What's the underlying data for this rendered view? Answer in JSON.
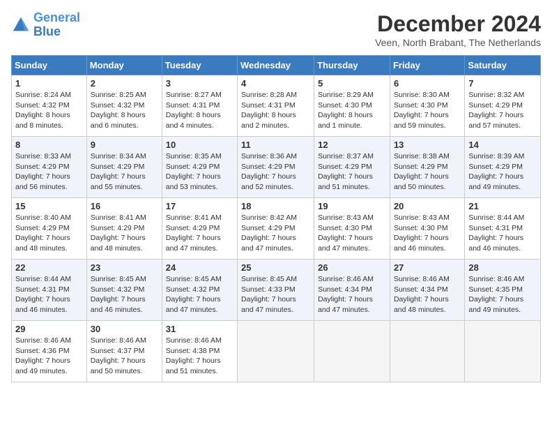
{
  "header": {
    "logo_line1": "General",
    "logo_line2": "Blue",
    "title": "December 2024",
    "subtitle": "Veen, North Brabant, The Netherlands"
  },
  "weekdays": [
    "Sunday",
    "Monday",
    "Tuesday",
    "Wednesday",
    "Thursday",
    "Friday",
    "Saturday"
  ],
  "weeks": [
    [
      {
        "day": "1",
        "info": "Sunrise: 8:24 AM\nSunset: 4:32 PM\nDaylight: 8 hours\nand 8 minutes."
      },
      {
        "day": "2",
        "info": "Sunrise: 8:25 AM\nSunset: 4:32 PM\nDaylight: 8 hours\nand 6 minutes."
      },
      {
        "day": "3",
        "info": "Sunrise: 8:27 AM\nSunset: 4:31 PM\nDaylight: 8 hours\nand 4 minutes."
      },
      {
        "day": "4",
        "info": "Sunrise: 8:28 AM\nSunset: 4:31 PM\nDaylight: 8 hours\nand 2 minutes."
      },
      {
        "day": "5",
        "info": "Sunrise: 8:29 AM\nSunset: 4:30 PM\nDaylight: 8 hours\nand 1 minute."
      },
      {
        "day": "6",
        "info": "Sunrise: 8:30 AM\nSunset: 4:30 PM\nDaylight: 7 hours\nand 59 minutes."
      },
      {
        "day": "7",
        "info": "Sunrise: 8:32 AM\nSunset: 4:29 PM\nDaylight: 7 hours\nand 57 minutes."
      }
    ],
    [
      {
        "day": "8",
        "info": "Sunrise: 8:33 AM\nSunset: 4:29 PM\nDaylight: 7 hours\nand 56 minutes."
      },
      {
        "day": "9",
        "info": "Sunrise: 8:34 AM\nSunset: 4:29 PM\nDaylight: 7 hours\nand 55 minutes."
      },
      {
        "day": "10",
        "info": "Sunrise: 8:35 AM\nSunset: 4:29 PM\nDaylight: 7 hours\nand 53 minutes."
      },
      {
        "day": "11",
        "info": "Sunrise: 8:36 AM\nSunset: 4:29 PM\nDaylight: 7 hours\nand 52 minutes."
      },
      {
        "day": "12",
        "info": "Sunrise: 8:37 AM\nSunset: 4:29 PM\nDaylight: 7 hours\nand 51 minutes."
      },
      {
        "day": "13",
        "info": "Sunrise: 8:38 AM\nSunset: 4:29 PM\nDaylight: 7 hours\nand 50 minutes."
      },
      {
        "day": "14",
        "info": "Sunrise: 8:39 AM\nSunset: 4:29 PM\nDaylight: 7 hours\nand 49 minutes."
      }
    ],
    [
      {
        "day": "15",
        "info": "Sunrise: 8:40 AM\nSunset: 4:29 PM\nDaylight: 7 hours\nand 48 minutes."
      },
      {
        "day": "16",
        "info": "Sunrise: 8:41 AM\nSunset: 4:29 PM\nDaylight: 7 hours\nand 48 minutes."
      },
      {
        "day": "17",
        "info": "Sunrise: 8:41 AM\nSunset: 4:29 PM\nDaylight: 7 hours\nand 47 minutes."
      },
      {
        "day": "18",
        "info": "Sunrise: 8:42 AM\nSunset: 4:29 PM\nDaylight: 7 hours\nand 47 minutes."
      },
      {
        "day": "19",
        "info": "Sunrise: 8:43 AM\nSunset: 4:30 PM\nDaylight: 7 hours\nand 47 minutes."
      },
      {
        "day": "20",
        "info": "Sunrise: 8:43 AM\nSunset: 4:30 PM\nDaylight: 7 hours\nand 46 minutes."
      },
      {
        "day": "21",
        "info": "Sunrise: 8:44 AM\nSunset: 4:31 PM\nDaylight: 7 hours\nand 46 minutes."
      }
    ],
    [
      {
        "day": "22",
        "info": "Sunrise: 8:44 AM\nSunset: 4:31 PM\nDaylight: 7 hours\nand 46 minutes."
      },
      {
        "day": "23",
        "info": "Sunrise: 8:45 AM\nSunset: 4:32 PM\nDaylight: 7 hours\nand 46 minutes."
      },
      {
        "day": "24",
        "info": "Sunrise: 8:45 AM\nSunset: 4:32 PM\nDaylight: 7 hours\nand 47 minutes."
      },
      {
        "day": "25",
        "info": "Sunrise: 8:45 AM\nSunset: 4:33 PM\nDaylight: 7 hours\nand 47 minutes."
      },
      {
        "day": "26",
        "info": "Sunrise: 8:46 AM\nSunset: 4:34 PM\nDaylight: 7 hours\nand 47 minutes."
      },
      {
        "day": "27",
        "info": "Sunrise: 8:46 AM\nSunset: 4:34 PM\nDaylight: 7 hours\nand 48 minutes."
      },
      {
        "day": "28",
        "info": "Sunrise: 8:46 AM\nSunset: 4:35 PM\nDaylight: 7 hours\nand 49 minutes."
      }
    ],
    [
      {
        "day": "29",
        "info": "Sunrise: 8:46 AM\nSunset: 4:36 PM\nDaylight: 7 hours\nand 49 minutes."
      },
      {
        "day": "30",
        "info": "Sunrise: 8:46 AM\nSunset: 4:37 PM\nDaylight: 7 hours\nand 50 minutes."
      },
      {
        "day": "31",
        "info": "Sunrise: 8:46 AM\nSunset: 4:38 PM\nDaylight: 7 hours\nand 51 minutes."
      },
      {
        "day": "",
        "info": ""
      },
      {
        "day": "",
        "info": ""
      },
      {
        "day": "",
        "info": ""
      },
      {
        "day": "",
        "info": ""
      }
    ]
  ]
}
